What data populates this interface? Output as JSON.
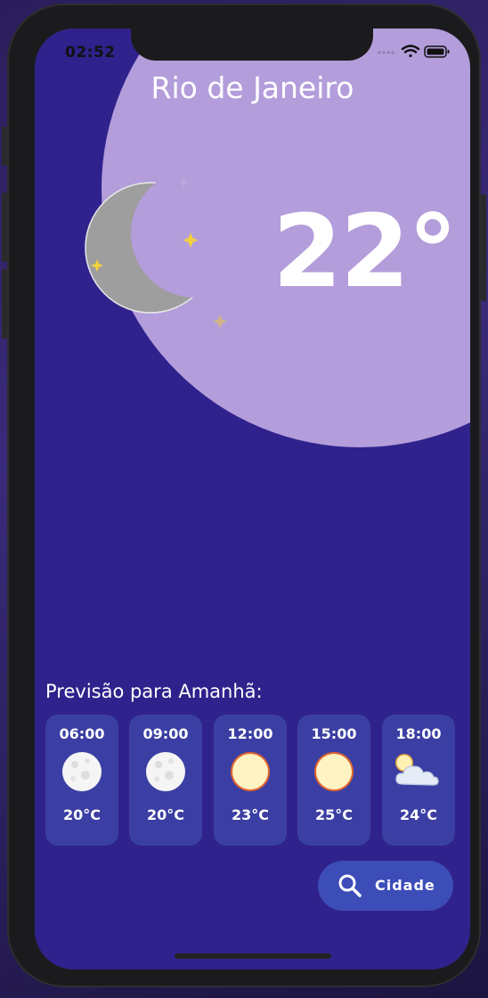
{
  "status": {
    "time": "02:52"
  },
  "city": "Rio de Janeiro",
  "current": {
    "temperature": "22°",
    "condition_icon": "moon-icon"
  },
  "forecast": {
    "title": "Previsão para Amanhã:",
    "items": [
      {
        "time": "06:00",
        "icon": "full-moon-icon",
        "temp": "20°C"
      },
      {
        "time": "09:00",
        "icon": "full-moon-icon",
        "temp": "20°C"
      },
      {
        "time": "12:00",
        "icon": "sun-icon",
        "temp": "23°C"
      },
      {
        "time": "15:00",
        "icon": "sun-icon",
        "temp": "25°C"
      },
      {
        "time": "18:00",
        "icon": "partly-cloudy-icon",
        "temp": "24°C"
      }
    ]
  },
  "search_button": {
    "label": "Cidade",
    "icon": "search-icon"
  },
  "colors": {
    "background": "#30228c",
    "blob": "#b39ddb",
    "card": "#3b3fa3",
    "button": "#3d4db8"
  }
}
